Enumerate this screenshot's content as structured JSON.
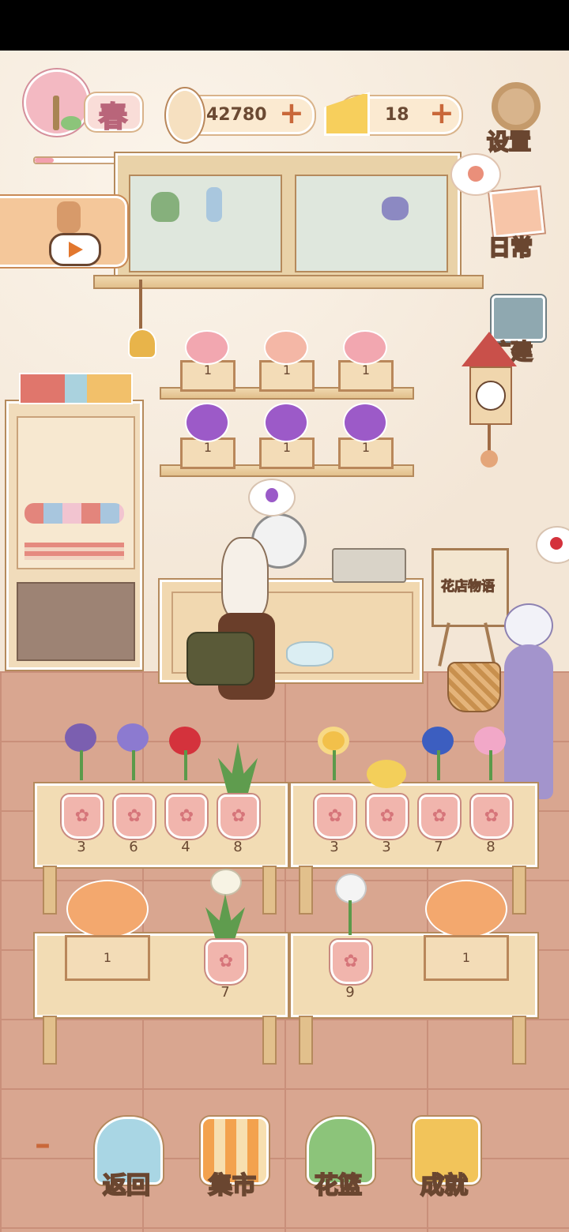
{
  "hud": {
    "season_label": "春",
    "fish_count": "42780",
    "cheese_count": "18",
    "plus": "+"
  },
  "side_buttons": {
    "settings": "设置",
    "daily": "日常",
    "expand": "扩建"
  },
  "bottom_nav": [
    {
      "label": "返回",
      "icon": "window-landscape-icon"
    },
    {
      "label": "集市",
      "icon": "market-stall-icon"
    },
    {
      "label": "花篮",
      "icon": "flower-basket-icon"
    },
    {
      "label": "成就",
      "icon": "trophy-icon"
    }
  ],
  "menu_dash": "–",
  "easel_sign": "花店物语",
  "wall_shelf_crates": [
    "1",
    "1",
    "1",
    "1",
    "1",
    "1"
  ],
  "upper_tables": {
    "left": [
      {
        "flower": "purple-rose",
        "color": "#7b5fb0",
        "count": "3"
      },
      {
        "flower": "purple-chrysanthemum",
        "color": "#8c7ad0",
        "count": "6"
      },
      {
        "flower": "red-poppy",
        "color": "#d4323c",
        "count": "4"
      },
      {
        "flower": "white-bud-leaves",
        "color": "#e8eed8",
        "count": "8"
      }
    ],
    "right": [
      {
        "flower": "sunflower",
        "color": "#f2c04a",
        "count": "3"
      },
      {
        "flower": "yellow-chrysanthemum",
        "color": "#f3cf5a",
        "count": "3"
      },
      {
        "flower": "blue-flower",
        "color": "#3c5ec0",
        "count": "7"
      },
      {
        "flower": "pink-lily",
        "color": "#f2a8c8",
        "count": "8"
      }
    ]
  },
  "lower_tables": {
    "left": [
      {
        "type": "crate",
        "count": "1"
      },
      {
        "type": "pot",
        "flower": "white-daffodil",
        "color": "#f7f3e4",
        "count": "7"
      }
    ],
    "right": [
      {
        "type": "pot",
        "flower": "white-rose",
        "color": "#f4f4f4",
        "count": "9"
      },
      {
        "type": "crate",
        "count": "1"
      }
    ]
  },
  "colors": {
    "wall": "#f6ece0",
    "floor": "#d9a690",
    "wood": "#e2c08c",
    "pot": "#f1b5ad",
    "outline": "#6b4a33"
  }
}
